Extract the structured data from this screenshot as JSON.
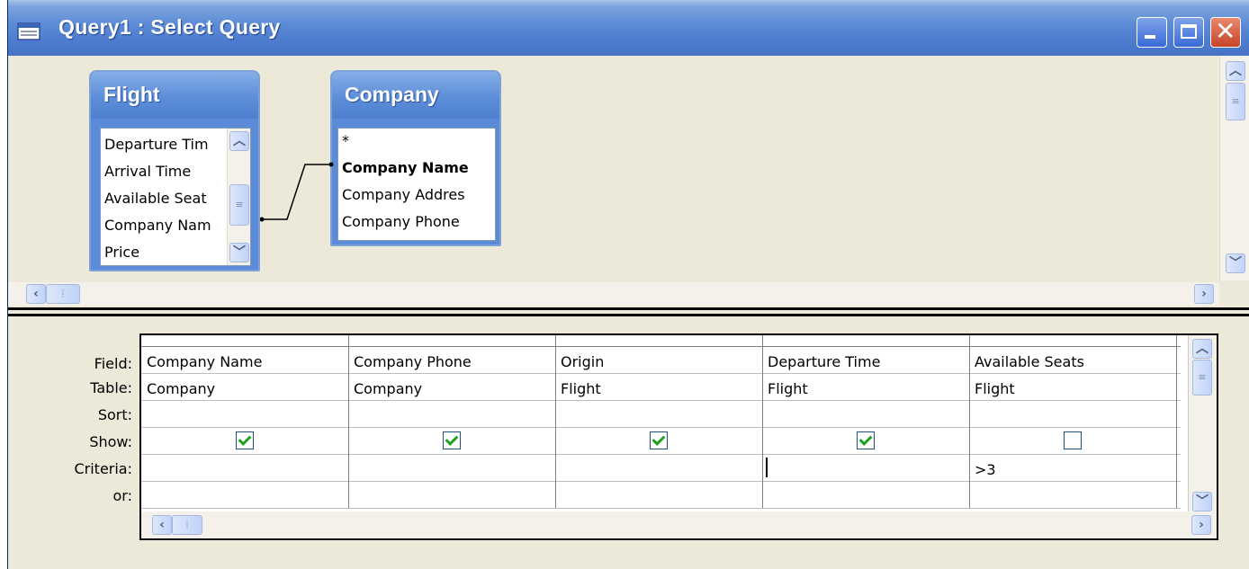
{
  "window": {
    "title": "Query1 : Select Query",
    "controls": {
      "minimize": "minimize",
      "maximize": "maximize",
      "close": "close"
    }
  },
  "tables": [
    {
      "name": "Flight",
      "fields": [
        "Departure Tim",
        "Arrival Time",
        "Available Seat",
        "Company Nam",
        "Price"
      ]
    },
    {
      "name": "Company",
      "fields": [
        "*",
        "Company Name",
        "Company Addres",
        "Company Phone"
      ],
      "bold_field": "Company Name"
    }
  ],
  "grid": {
    "row_labels": [
      "Field:",
      "Table:",
      "Sort:",
      "Show:",
      "Criteria:",
      "or:"
    ],
    "columns": [
      {
        "field": "Company Name",
        "table": "Company",
        "sort": "",
        "show": true,
        "criteria": "",
        "or": ""
      },
      {
        "field": "Company Phone",
        "table": "Company",
        "sort": "",
        "show": true,
        "criteria": "",
        "or": ""
      },
      {
        "field": "Origin",
        "table": "Flight",
        "sort": "",
        "show": true,
        "criteria": "",
        "or": ""
      },
      {
        "field": "Departure Time",
        "table": "Flight",
        "sort": "",
        "show": true,
        "criteria": "",
        "or": ""
      },
      {
        "field": "Available Seats",
        "table": "Flight",
        "sort": "",
        "show": false,
        "criteria": ">3",
        "or": ""
      }
    ]
  },
  "colors": {
    "titlebar": "#4d7ccf",
    "table_header": "#5d8ed9",
    "checkbox_check": "#21a121"
  }
}
